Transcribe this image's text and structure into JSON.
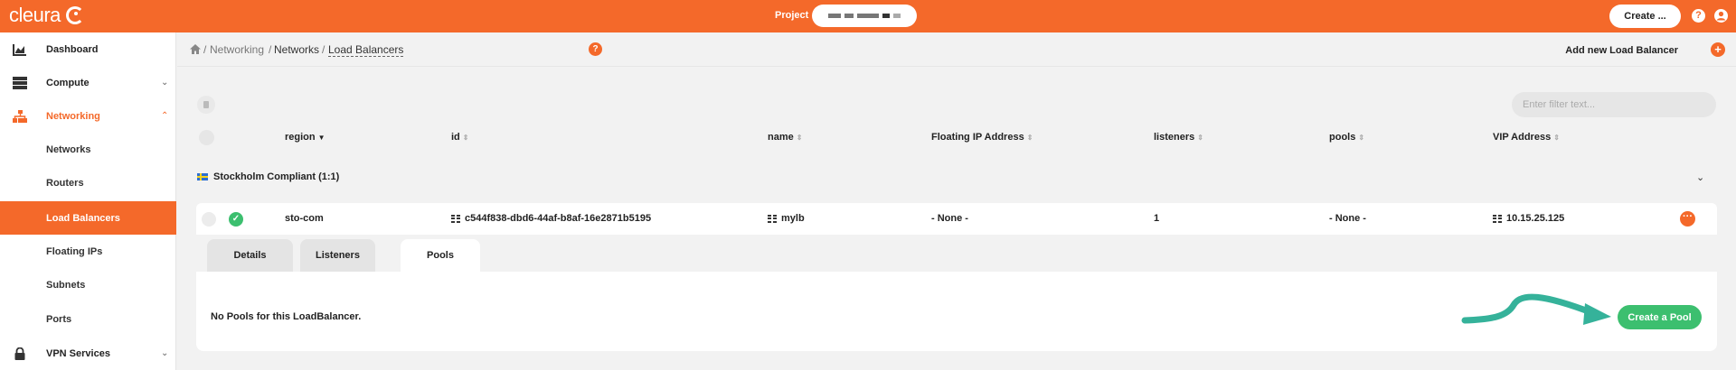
{
  "header": {
    "logo_text": "cleura",
    "project_label": "Project",
    "create_label": "Create ...",
    "help_icon": "help-icon",
    "user_icon": "user-icon",
    "accent_color": "#f4692a"
  },
  "sidebar": {
    "items": [
      {
        "label": "Dashboard",
        "icon": "chart-icon"
      },
      {
        "label": "Compute",
        "icon": "server-icon"
      },
      {
        "label": "Networking",
        "icon": "network-icon"
      },
      {
        "label": "Networks"
      },
      {
        "label": "Routers"
      },
      {
        "label": "Load Balancers"
      },
      {
        "label": "Floating IPs"
      },
      {
        "label": "Subnets"
      },
      {
        "label": "Ports"
      },
      {
        "label": "VPN Services",
        "icon": "lock-icon"
      }
    ]
  },
  "breadcrumb": {
    "items": [
      "Networking",
      "Networks",
      "Load Balancers"
    ],
    "separator": "/",
    "add_label": "Add new Load Balancer"
  },
  "filter": {
    "placeholder": "Enter filter text..."
  },
  "table": {
    "columns": [
      "region",
      "id",
      "name",
      "Floating IP Address",
      "listeners",
      "pools",
      "VIP Address"
    ],
    "group_label": "Stockholm Compliant (1:1)",
    "row": {
      "region": "sto-com",
      "id": "c544f838-dbd6-44af-b8af-16e2871b5195",
      "name": "mylb",
      "floating_ip": "- None -",
      "listeners": "1",
      "pools": "- None -",
      "vip": "10.15.25.125"
    }
  },
  "detail": {
    "tabs": [
      "Details",
      "Listeners",
      "Pools"
    ],
    "active_tab": "Pools",
    "empty_message": "No Pools for this LoadBalancer.",
    "create_pool_label": "Create a Pool",
    "create_pool_color": "#3cbf6f"
  }
}
